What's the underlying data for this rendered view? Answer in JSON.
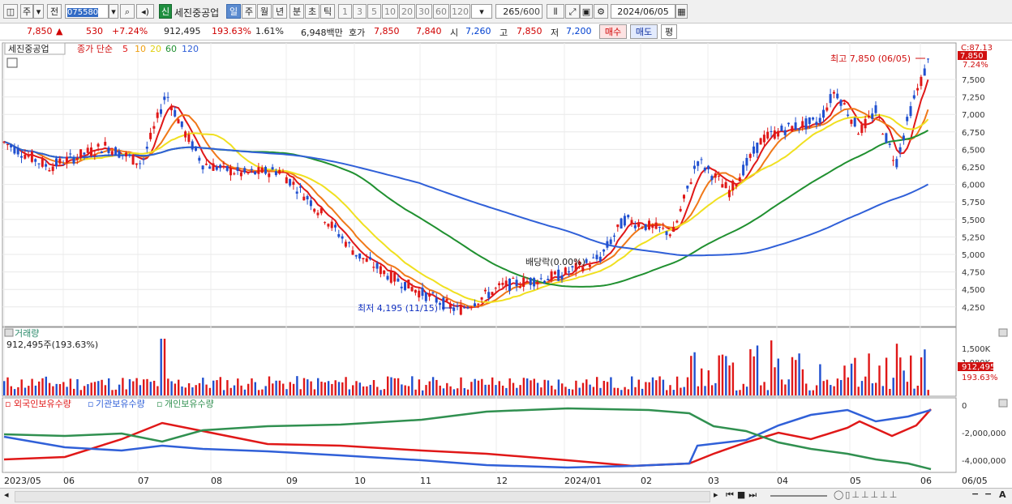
{
  "toolbar": {
    "market": "주",
    "prev_label": "전",
    "stock_code": "075580",
    "new_badge": "신",
    "stock_name": "세진중공업",
    "periods": [
      "일",
      "주",
      "월",
      "년",
      "분",
      "초",
      "틱"
    ],
    "selected_period": "일",
    "intervals": [
      "1",
      "3",
      "5",
      "10",
      "20",
      "30",
      "60",
      "120"
    ],
    "count": "265",
    "count_total": "/600",
    "date": "2024/06/05"
  },
  "quote": {
    "price": "7,850",
    "change_arrow": "▲",
    "change": "530",
    "change_pct": "+7.24%",
    "volume": "912,495",
    "volume_pct": "193.63%",
    "turnover": "1.61%",
    "amount": "6,948백만",
    "hoga_label": "호가",
    "ask": "7,850",
    "bid": "7,840",
    "open_label": "시",
    "open": "7,260",
    "high_label": "고",
    "high": "7,850",
    "low_label": "저",
    "low": "7,200",
    "buy_btn": "매수",
    "sell_btn": "매도",
    "eval_btn": "평"
  },
  "price_panel": {
    "legend_name": "세진중공업",
    "legend_ma_label": "종가 단순",
    "ma_periods": [
      "5",
      "10",
      "20",
      "60",
      "120"
    ],
    "ma_colors": [
      "#e01818",
      "#f07818",
      "#f0e020",
      "#209030",
      "#3060d8"
    ],
    "axis_ticks": [
      "7,500",
      "7,250",
      "7,000",
      "6,750",
      "6,500",
      "6,250",
      "6,000",
      "5,750",
      "5,500",
      "5,250",
      "5,000",
      "4,750",
      "4,500",
      "4,250"
    ],
    "current_price_tag": "7,850",
    "current_pct_tag": "7.24%",
    "top_tag": "C:87.13",
    "high_annotation": "최고 7,850 (06/05)",
    "low_annotation": "최저 4,195 (11/15)",
    "dividend_annotation": "배당락(0.00%)"
  },
  "volume_panel": {
    "title": "거래량",
    "info": "912,495주(193.63%)",
    "axis_ticks": [
      "1,500K",
      "1,000K"
    ],
    "current_tag": "912,495",
    "current_pct_tag": "193.63%"
  },
  "holdings_panel": {
    "legend": [
      {
        "label": "외국인보유수량",
        "color": "#e01818"
      },
      {
        "label": "기관보유수량",
        "color": "#3060d8"
      },
      {
        "label": "개인보유수량",
        "color": "#309050"
      }
    ],
    "axis_ticks": [
      "0",
      "-2,000,000",
      "-4,000,000"
    ]
  },
  "x_axis": {
    "labels": [
      "2023/05",
      "06",
      "07",
      "08",
      "09",
      "10",
      "11",
      "12",
      "2024/01",
      "02",
      "03",
      "04",
      "05",
      "06"
    ],
    "right_label": "06/05"
  }
}
